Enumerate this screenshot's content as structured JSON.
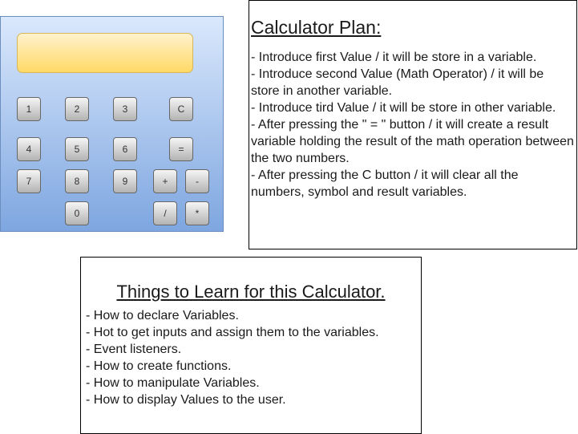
{
  "calculator": {
    "keys": {
      "k1": "1",
      "k2": "2",
      "k3": "3",
      "kc": "C",
      "k4": "4",
      "k5": "5",
      "k6": "6",
      "keq": "=",
      "k7": "7",
      "k8": "8",
      "k9": "9",
      "kplus": "+",
      "kminus": "-",
      "k0": "0",
      "kdiv": "/",
      "kmul": "*"
    },
    "colors": {
      "body_border": "#6c8ebf",
      "body_top": "#dae8fc",
      "body_bottom": "#7ea6e0",
      "display_border": "#d6b656",
      "display_top": "#fff2cc",
      "display_bottom": "#ffd966"
    }
  },
  "plan": {
    "title": "Calculator Plan:",
    "items": [
      "  - Introduce first Value / it will be store in a variable.",
      "  - Introduce second Value (Math Operator) / it will be store in another variable.",
      "  - Introduce tird Value / it will be store in other variable.",
      "  - After pressing the \" = \" button / it will create a result variable holding the result of the math operation between the two numbers.",
      "  - After pressing the C button / it will clear all the numbers, symbol and result variables."
    ]
  },
  "learn": {
    "title": "Things to Learn for this Calculator.",
    "items": [
      "- How to declare Variables.",
      "- Hot to get inputs and assign them to the variables.",
      "- Event listeners.",
      "- How to create functions.",
      "- How to manipulate Variables.",
      "- How to display Values to the user."
    ]
  }
}
